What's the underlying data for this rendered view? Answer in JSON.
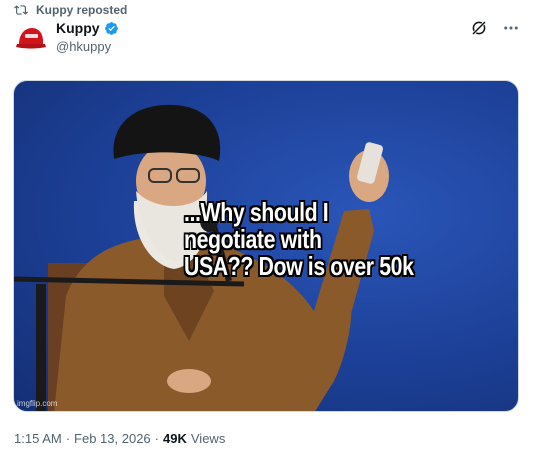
{
  "repost": {
    "label": "Kuppy reposted",
    "icon": "repost-icon"
  },
  "author": {
    "name": "Kuppy",
    "handle": "@hkuppy",
    "verified": true,
    "verified_color": "#1d9bf0"
  },
  "actions": {
    "grok_icon": "grok-icon",
    "more_icon": "more-icon"
  },
  "media": {
    "meme_lines": [
      "...Why should I",
      "negotiate with",
      "USA?? Dow is over 50k"
    ],
    "watermark": "imgflip.com"
  },
  "meta": {
    "time": "1:15 AM",
    "sep1": "·",
    "date": "Feb 13, 2026",
    "sep2": "·",
    "views_count": "49K",
    "views_label": "Views"
  },
  "colors": {
    "secondary_text": "#536471",
    "primary_text": "#0f1419",
    "media_blue": "#1c3f96"
  }
}
